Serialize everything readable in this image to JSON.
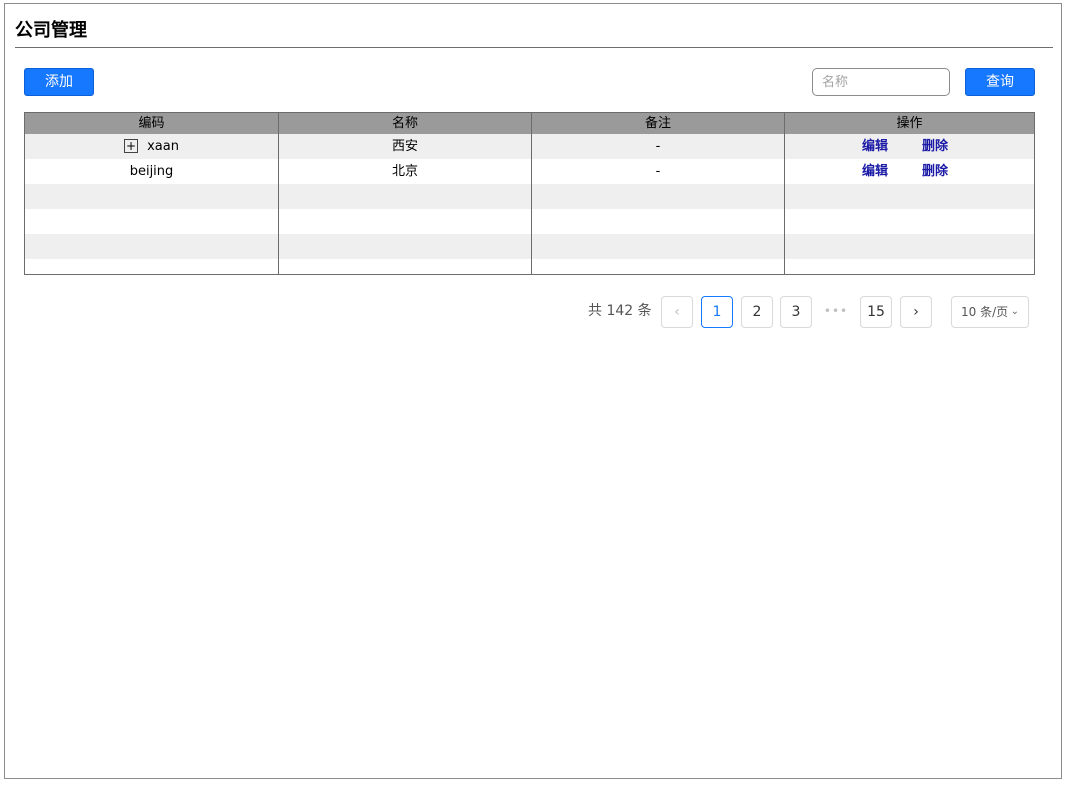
{
  "page": {
    "title": "公司管理"
  },
  "toolbar": {
    "add_label": "添加",
    "search_placeholder": "名称",
    "search_value": "",
    "query_label": "查询"
  },
  "table": {
    "columns": [
      "编码",
      "名称",
      "备注",
      "操作"
    ],
    "rows": [
      {
        "code": "xaan",
        "expandable": true,
        "expand_icon": "plus-icon",
        "expand_glyph": "+",
        "name": "西安",
        "note": "-",
        "edit": "编辑",
        "delete": "删除"
      },
      {
        "code": "beijing",
        "expandable": false,
        "name": "北京",
        "note": "-",
        "edit": "编辑",
        "delete": "删除"
      }
    ]
  },
  "pagination": {
    "total_text": "共 142 条",
    "pages": [
      "1",
      "2",
      "3",
      "15"
    ],
    "current": "1",
    "ellipsis": "•••",
    "page_size": "10 条/页",
    "prev_icon": "chevron-left-icon",
    "next_icon": "chevron-right-icon",
    "prev_glyph": "‹",
    "next_glyph": "›",
    "dropdown_icon": "chevron-down-icon",
    "dropdown_glyph": "⌄"
  },
  "colors": {
    "primary": "#1677ff",
    "header_bg": "#9a9a9a",
    "alt_row_bg": "#efefef",
    "link": "#1a1aa6"
  }
}
